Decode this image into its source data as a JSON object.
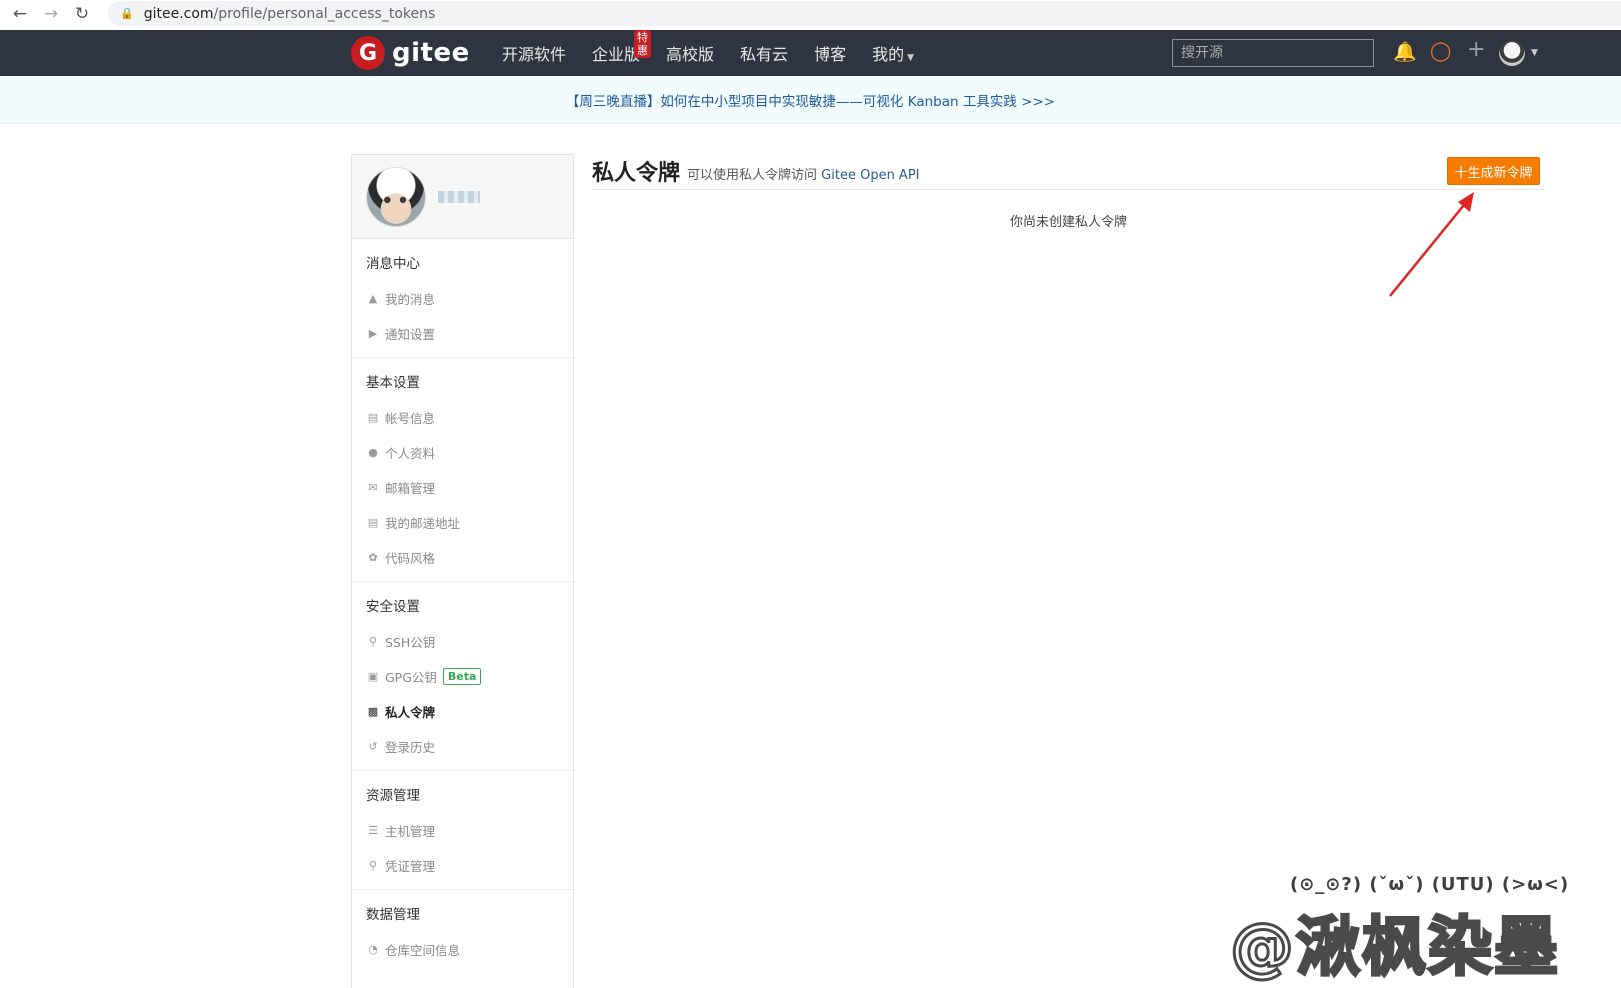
{
  "browser": {
    "url_host": "gitee.com",
    "url_path": "/profile/personal_access_tokens"
  },
  "header": {
    "logo_badge": "G",
    "logo_text": "gitee",
    "nav": [
      {
        "label": "开源软件"
      },
      {
        "label": "企业版",
        "badge": "特惠"
      },
      {
        "label": "高校版"
      },
      {
        "label": "私有云"
      },
      {
        "label": "博客"
      },
      {
        "label": "我的"
      }
    ],
    "search_placeholder": "搜开源"
  },
  "notice": {
    "text": "【周三晚直播】如何在中小型项目中实现敏捷——可视化 Kanban 工具实践 >>>"
  },
  "sidebar": {
    "groups": [
      {
        "title": "消息中心",
        "items": [
          {
            "label": "我的消息",
            "icon": "bell-icon"
          },
          {
            "label": "通知设置",
            "icon": "speaker-icon"
          }
        ]
      },
      {
        "title": "基本设置",
        "items": [
          {
            "label": "帐号信息",
            "icon": "id-card-icon"
          },
          {
            "label": "个人资料",
            "icon": "user-icon"
          },
          {
            "label": "邮箱管理",
            "icon": "envelope-icon"
          },
          {
            "label": "我的邮递地址",
            "icon": "address-card-icon"
          },
          {
            "label": "代码风格",
            "icon": "palette-icon"
          }
        ]
      },
      {
        "title": "安全设置",
        "items": [
          {
            "label": "SSH公钥",
            "icon": "key-icon"
          },
          {
            "label": "GPG公钥",
            "icon": "lock-icon",
            "badge": "Beta"
          },
          {
            "label": "私人令牌",
            "icon": "token-icon",
            "active": true
          },
          {
            "label": "登录历史",
            "icon": "history-icon"
          }
        ]
      },
      {
        "title": "资源管理",
        "items": [
          {
            "label": "主机管理",
            "icon": "server-icon"
          },
          {
            "label": "凭证管理",
            "icon": "key-icon"
          }
        ]
      },
      {
        "title": "数据管理",
        "items": [
          {
            "label": "仓库空间信息",
            "icon": "pie-chart-icon"
          }
        ]
      }
    ]
  },
  "main": {
    "title": "私人令牌",
    "desc_prefix": "可以使用私人令牌访问",
    "desc_api": "Gitee Open API",
    "new_button": "十生成新令牌",
    "empty_text": "你尚未创建私人令牌"
  },
  "watermark": {
    "top": "(⊙_⊙?) (ˇωˇ) (UTU) (>ω<)",
    "main": "@湫枫染墨"
  },
  "colors": {
    "header_bg": "#2e3440",
    "brand_red": "#c71d23",
    "accent_orange": "#f57c00",
    "notice_bg": "#f2fbfd",
    "link_blue": "#1e5aa0",
    "annotation_red": "#e02424"
  }
}
